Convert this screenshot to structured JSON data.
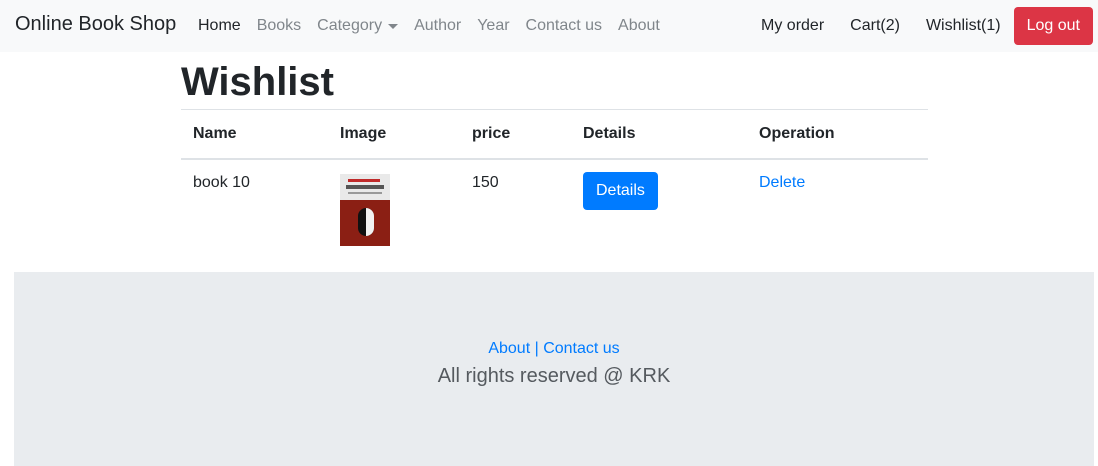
{
  "navbar": {
    "brand": "Online Book Shop",
    "left_links": [
      {
        "label": "Home"
      },
      {
        "label": "Books"
      },
      {
        "label": "Category"
      },
      {
        "label": "Author"
      },
      {
        "label": "Year"
      },
      {
        "label": "Contact us"
      },
      {
        "label": "About"
      }
    ],
    "right_links": [
      {
        "label": "My order"
      },
      {
        "label": "Cart(2)"
      },
      {
        "label": "Wishlist(1)"
      }
    ],
    "logout_label": "Log out"
  },
  "page": {
    "title": "Wishlist"
  },
  "table": {
    "headers": [
      "Name",
      "Image",
      "price",
      "Details",
      "Operation"
    ],
    "rows": [
      {
        "name": "book 10",
        "price": "150",
        "details_label": "Details",
        "operation_label": "Delete"
      }
    ]
  },
  "footer": {
    "about_label": "About",
    "separator": " | ",
    "contact_label": "Contact us",
    "copyright": "All rights reserved @ KRK"
  },
  "colors": {
    "navbar_bg": "#f8f9fa",
    "primary": "#007bff",
    "danger": "#dc3545",
    "footer_bg": "#e9ecef"
  },
  "icons": {
    "category_dropdown": "caret-down-icon"
  }
}
